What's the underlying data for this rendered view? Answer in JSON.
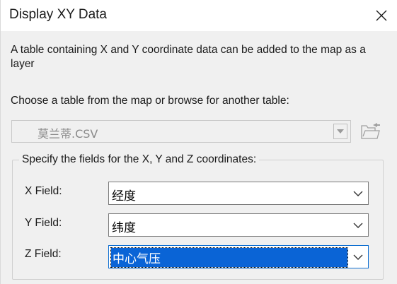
{
  "dialog": {
    "title": "Display XY Data",
    "close_icon": "close-icon"
  },
  "description": "A table containing X and Y coordinate data can be added to the map as a layer",
  "table_chooser": {
    "label": "Choose a table from the map or browse for another table:",
    "selected_value": "莫兰蒂.CSV",
    "enabled": false,
    "browse_icon": "open-folder-icon"
  },
  "coordinates": {
    "group_title": "Specify the fields for the X, Y and Z coordinates:",
    "x": {
      "label": "X Field:",
      "value": "经度"
    },
    "y": {
      "label": "Y Field:",
      "value": "纬度"
    },
    "z": {
      "label": "Z Field:",
      "value": "中心气压",
      "focused": true
    }
  },
  "colors": {
    "selection_highlight": "#0a64d6",
    "focus_border": "#0f6fd1",
    "dialog_background": "#f0f0f0"
  }
}
